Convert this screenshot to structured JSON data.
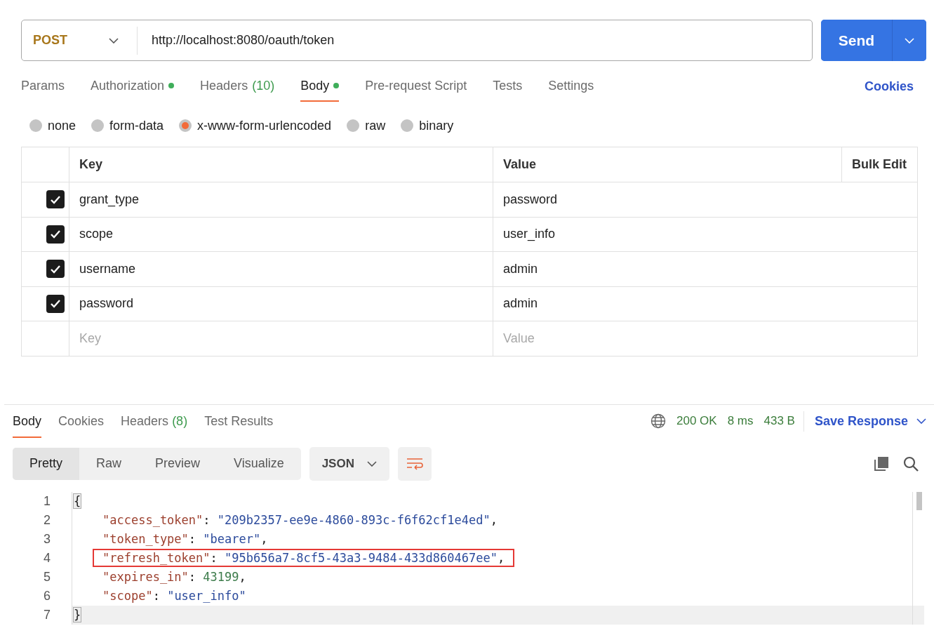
{
  "request": {
    "method": "POST",
    "url": "http://localhost:8080/oauth/token",
    "send": "Send"
  },
  "request_tabs": [
    {
      "label": "Params",
      "dot": false,
      "selected": false
    },
    {
      "label": "Authorization",
      "dot": true,
      "selected": false
    },
    {
      "label": "Headers",
      "count": "(10)",
      "dot": false,
      "selected": false
    },
    {
      "label": "Body",
      "dot": true,
      "selected": true
    },
    {
      "label": "Pre-request Script",
      "dot": false,
      "selected": false
    },
    {
      "label": "Tests",
      "dot": false,
      "selected": false
    },
    {
      "label": "Settings",
      "dot": false,
      "selected": false
    }
  ],
  "cookies_link": "Cookies",
  "body_types": [
    {
      "label": "none",
      "selected": false
    },
    {
      "label": "form-data",
      "selected": false
    },
    {
      "label": "x-www-form-urlencoded",
      "selected": true
    },
    {
      "label": "raw",
      "selected": false
    },
    {
      "label": "binary",
      "selected": false
    }
  ],
  "params_table": {
    "columns": [
      "Key",
      "Value"
    ],
    "bulk_edit": "Bulk Edit",
    "rows": [
      {
        "key": "grant_type",
        "value": "password",
        "checked": true
      },
      {
        "key": "scope",
        "value": "user_info",
        "checked": true
      },
      {
        "key": "username",
        "value": "admin",
        "checked": true
      },
      {
        "key": "password",
        "value": "admin",
        "checked": true
      }
    ],
    "new_row": {
      "key_placeholder": "Key",
      "value_placeholder": "Value"
    }
  },
  "response": {
    "tabs": [
      {
        "label": "Body",
        "selected": true
      },
      {
        "label": "Cookies",
        "selected": false
      },
      {
        "label": "Headers",
        "count": "(8)",
        "selected": false
      },
      {
        "label": "Test Results",
        "selected": false
      }
    ],
    "status": "200 OK",
    "time": "8 ms",
    "size": "433 B",
    "save": "Save Response",
    "view_modes": [
      {
        "label": "Pretty",
        "selected": true
      },
      {
        "label": "Raw",
        "selected": false
      },
      {
        "label": "Preview",
        "selected": false
      },
      {
        "label": "Visualize",
        "selected": false
      }
    ],
    "format": "JSON",
    "lines": [
      {
        "number": "1",
        "active": false,
        "boxed": false,
        "tokens": [
          {
            "kind": "bracket",
            "text": "{"
          }
        ]
      },
      {
        "number": "2",
        "active": false,
        "boxed": false,
        "tokens": [
          {
            "kind": "key",
            "text": "\"access_token\""
          },
          {
            "kind": "punct",
            "text": ": "
          },
          {
            "kind": "string",
            "text": "\"209b2357-ee9e-4860-893c-f6f62cf1e4ed\""
          },
          {
            "kind": "punct",
            "text": ","
          }
        ]
      },
      {
        "number": "3",
        "active": false,
        "boxed": false,
        "tokens": [
          {
            "kind": "key",
            "text": "\"token_type\""
          },
          {
            "kind": "punct",
            "text": ": "
          },
          {
            "kind": "string",
            "text": "\"bearer\""
          },
          {
            "kind": "punct",
            "text": ","
          }
        ]
      },
      {
        "number": "4",
        "active": false,
        "boxed": true,
        "tokens": [
          {
            "kind": "key",
            "text": "\"refresh_token\""
          },
          {
            "kind": "punct",
            "text": ": "
          },
          {
            "kind": "string",
            "text": "\"95b656a7-8cf5-43a3-9484-433d860467ee\""
          },
          {
            "kind": "punct",
            "text": ","
          }
        ]
      },
      {
        "number": "5",
        "active": false,
        "boxed": false,
        "tokens": [
          {
            "kind": "key",
            "text": "\"expires_in\""
          },
          {
            "kind": "punct",
            "text": ": "
          },
          {
            "kind": "number",
            "text": "43199"
          },
          {
            "kind": "punct",
            "text": ","
          }
        ]
      },
      {
        "number": "6",
        "active": false,
        "boxed": false,
        "tokens": [
          {
            "kind": "key",
            "text": "\"scope\""
          },
          {
            "kind": "punct",
            "text": ": "
          },
          {
            "kind": "string",
            "text": "\"user_info\""
          }
        ]
      },
      {
        "number": "7",
        "active": true,
        "boxed": false,
        "tokens": [
          {
            "kind": "bracket",
            "text": "}"
          }
        ]
      }
    ]
  }
}
